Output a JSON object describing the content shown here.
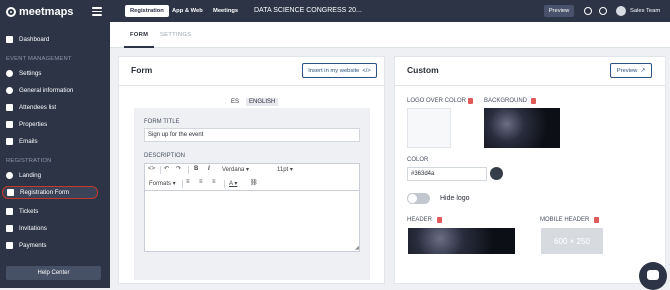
{
  "brand": {
    "name": "meetmaps"
  },
  "sidebar": {
    "items": [
      {
        "label": "Dashboard"
      },
      {
        "section": "EVENT MANAGEMENT"
      },
      {
        "label": "Settings"
      },
      {
        "label": "General information"
      },
      {
        "label": "Attendees list"
      },
      {
        "label": "Properties"
      },
      {
        "label": "Emails"
      },
      {
        "section": "REGISTRATION"
      },
      {
        "label": "Landing"
      },
      {
        "label": "Registration Form"
      },
      {
        "label": "Tickets"
      },
      {
        "label": "Invitations"
      },
      {
        "label": "Payments"
      }
    ],
    "help": "Help Center"
  },
  "topbar": {
    "tabs": [
      "Registration",
      "App & Web",
      "Meetings"
    ],
    "event_title": "DATA SCIENCE CONGRESS 20...",
    "preview": "Preview",
    "user": "Sales Team"
  },
  "subtabs": [
    "FORM",
    "SETTINGS"
  ],
  "form_panel": {
    "title": "Form",
    "insert_button": "Insert in my website",
    "langs": [
      "ES",
      "ENGLISH"
    ],
    "form_title_label": "FORM TITLE",
    "form_title_value": "Sign up for the event",
    "description_label": "DESCRIPTION",
    "toolbar": {
      "font": "Verdana",
      "size": "11pt",
      "formats": "Formats"
    }
  },
  "custom_panel": {
    "title": "Custom",
    "preview_button": "Preview",
    "logo_label": "LOGO OVER COLOR",
    "background_label": "BACKGROUND",
    "color_label": "COLOR",
    "color_value": "#363d4a",
    "hide_logo": "Hide logo",
    "header_label": "HEADER",
    "mobile_header_label": "MOBILE HEADER",
    "mobile_placeholder": "600 × 250"
  },
  "colors": {
    "sidebar": "#2c3446",
    "accent": "#2c5282",
    "highlight": "#c0392b",
    "swatch": "#363d4a"
  }
}
